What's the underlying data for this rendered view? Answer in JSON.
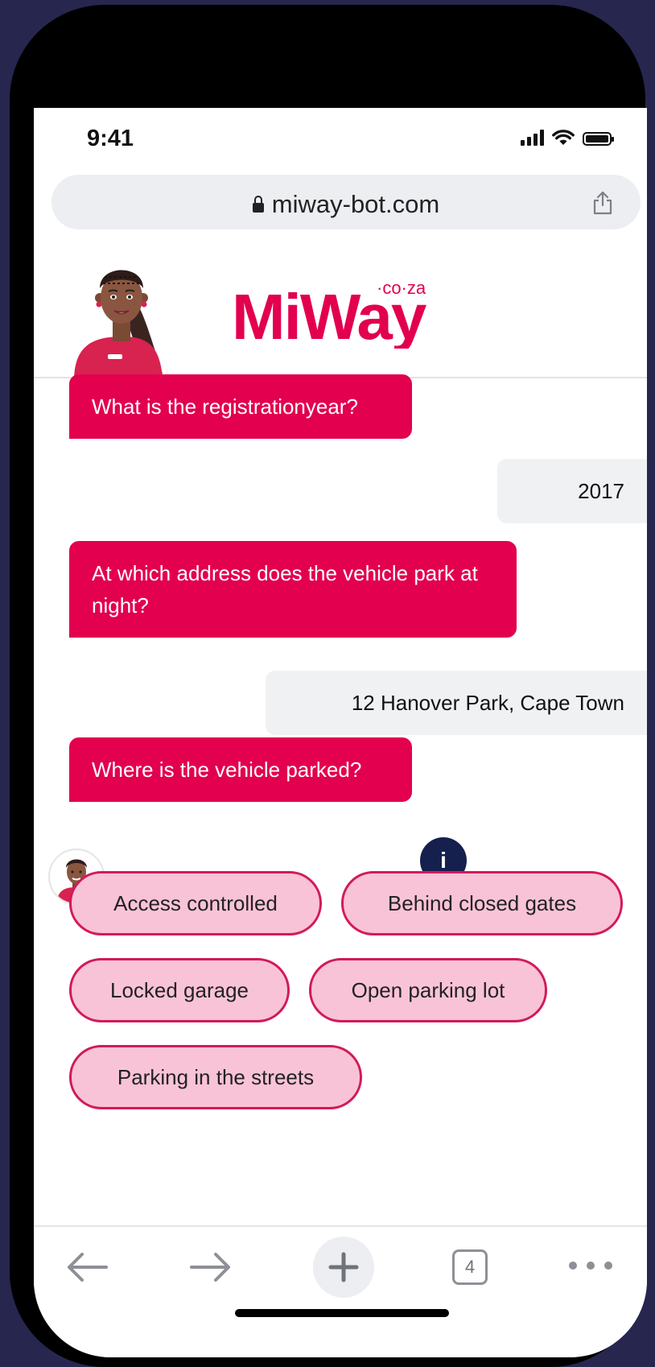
{
  "status_bar": {
    "time": "9:41"
  },
  "browser": {
    "url": "miway-bot.com",
    "tab_count": "4"
  },
  "brand": {
    "logo_text": "MiWay",
    "logo_domain": "co·za",
    "primary_color": "#e2004f"
  },
  "chat": {
    "messages": [
      {
        "sender": "bot",
        "text": "What is the registrationyear?"
      },
      {
        "sender": "user",
        "text": "2017"
      },
      {
        "sender": "bot",
        "text": "At which address does the vehicle park at night?"
      },
      {
        "sender": "user",
        "text": "12 Hanover Park, Cape Town"
      },
      {
        "sender": "bot",
        "text": "Where is the vehicle parked?"
      }
    ],
    "info_label": "i",
    "options": [
      "Access controlled",
      "Behind closed gates",
      "Locked garage",
      "Open parking lot",
      "Parking in the streets"
    ]
  }
}
